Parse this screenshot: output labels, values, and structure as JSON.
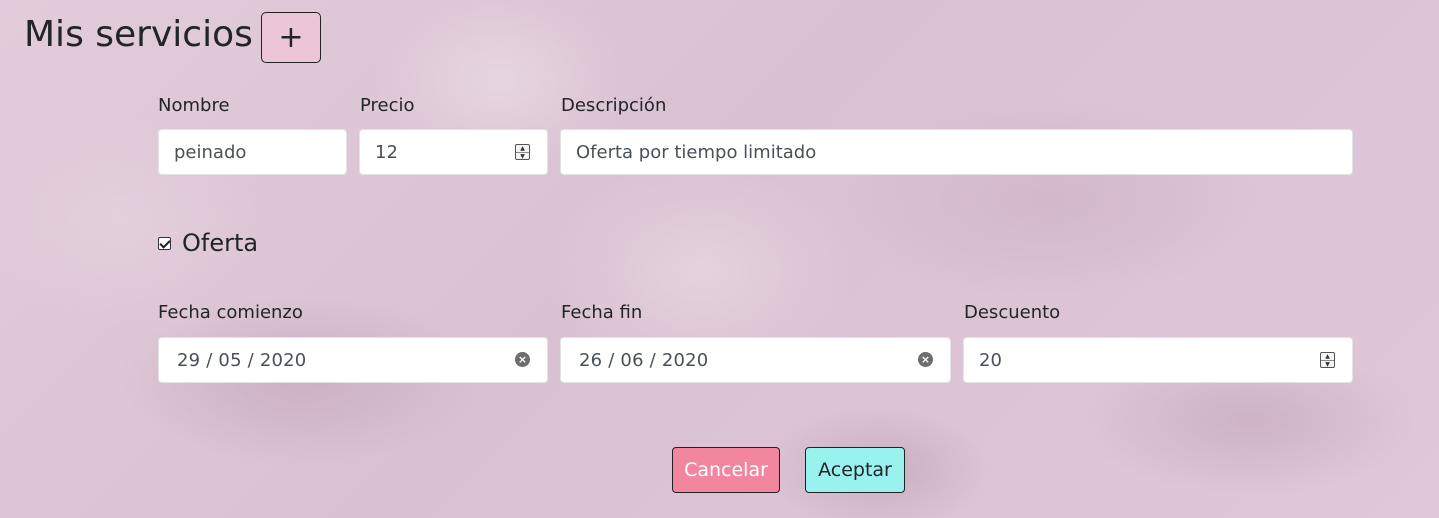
{
  "header": {
    "title": "Mis servicios",
    "add_label": "+"
  },
  "form": {
    "nombre": {
      "label": "Nombre",
      "value": "peinado"
    },
    "precio": {
      "label": "Precio",
      "value": "12"
    },
    "descripcion": {
      "label": "Descripción",
      "value": "Oferta por tiempo limitado"
    },
    "oferta": {
      "label": "Oferta",
      "checked": true
    },
    "fecha_comienzo": {
      "label": "Fecha comienzo",
      "value": "29 / 05 / 2020"
    },
    "fecha_fin": {
      "label": "Fecha fin",
      "value": "26 / 06 / 2020"
    },
    "descuento": {
      "label": "Descuento",
      "value": "20"
    }
  },
  "actions": {
    "cancel_label": "Cancelar",
    "accept_label": "Aceptar"
  },
  "colors": {
    "cancel": "#f3869f",
    "accept": "#9af2ee",
    "add_button": "#ecc5d8"
  },
  "icons": {
    "clear": "clear-circle-icon",
    "spinner": "number-spinner-icon",
    "check": "checkmark-icon"
  }
}
